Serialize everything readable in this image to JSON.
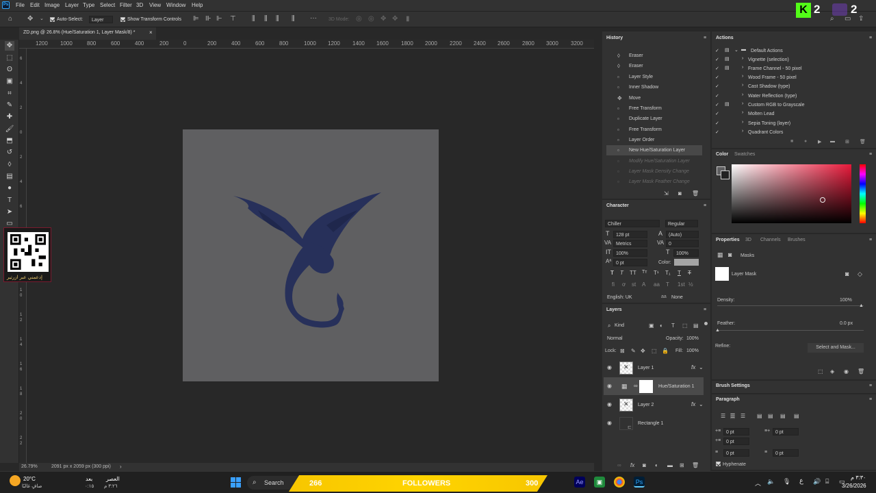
{
  "menubar": {
    "logo": "Ps",
    "items": [
      "File",
      "Edit",
      "Image",
      "Layer",
      "Type",
      "Select",
      "Filter",
      "3D",
      "View",
      "Window",
      "Help"
    ]
  },
  "options": {
    "auto_select_label": "Auto-Select:",
    "auto_select_value": "Layer",
    "show_transform_label": "Show Transform Controls",
    "mode_3d_label": "3D Mode:"
  },
  "doc_tab": {
    "title": "ZD.png @ 26.8% (Hue/Saturation 1, Layer Mask/8) *",
    "close": "×"
  },
  "ruler_h": [
    "1200",
    "1000",
    "800",
    "600",
    "400",
    "200",
    "0",
    "200",
    "400",
    "600",
    "800",
    "1000",
    "1200",
    "1400",
    "1600",
    "1800",
    "2000",
    "2200",
    "2400",
    "2600",
    "2800",
    "3000",
    "3200"
  ],
  "ruler_v": [
    "6",
    "4",
    "2",
    "0",
    "2",
    "4",
    "6",
    "8",
    "1",
    "0",
    "1",
    "2",
    "1",
    "4",
    "1",
    "6",
    "1",
    "8",
    "2",
    "0",
    "2",
    "2",
    "2",
    "4",
    "2",
    "6",
    "2",
    "8",
    "3",
    "0"
  ],
  "qr": {
    "caption": "إدعمني عبر ازرتير"
  },
  "status": {
    "zoom": "26.79%",
    "doc_info": "2091 px x 2059 px (300 ppi)"
  },
  "history": {
    "title": "History",
    "items": [
      {
        "label": "Eraser",
        "icon": "eraser-icon"
      },
      {
        "label": "Eraser",
        "icon": "eraser-icon"
      },
      {
        "label": "Layer Style",
        "icon": "doc-icon"
      },
      {
        "label": "Inner Shadow",
        "icon": "doc-icon"
      },
      {
        "label": "Move",
        "icon": "move-icon"
      },
      {
        "label": "Free Transform",
        "icon": "doc-icon"
      },
      {
        "label": "Duplicate Layer",
        "icon": "doc-icon"
      },
      {
        "label": "Free Transform",
        "icon": "doc-icon"
      },
      {
        "label": "Layer Order",
        "icon": "doc-icon"
      },
      {
        "label": "New Hue/Saturation Layer",
        "icon": "doc-icon"
      },
      {
        "label": "Modify Hue/Saturation Layer",
        "icon": "doc-icon"
      },
      {
        "label": "Layer Mask Density Change",
        "icon": "doc-icon"
      },
      {
        "label": "Layer Mask Feather Change",
        "icon": "doc-icon"
      }
    ]
  },
  "actions": {
    "title": "Actions",
    "group": "Default Actions",
    "items": [
      "Vignette (selection)",
      "Frame Channel - 50 pixel",
      "Wood Frame - 50 pixel",
      "Cast Shadow (type)",
      "Water Reflection (type)",
      "Custom RGB to Grayscale",
      "Molten Lead",
      "Sepia Toning (layer)",
      "Quadrant Colors"
    ]
  },
  "color": {
    "tab1": "Color",
    "tab2": "Swatches"
  },
  "character": {
    "title": "Character",
    "font": "Chiller",
    "style": "Regular",
    "size": "128 pt",
    "leading": "(Auto)",
    "kerning": "Metrics",
    "tracking": "0",
    "vscale": "100%",
    "hscale": "100%",
    "baseline": "0 pt",
    "color_label": "Color:",
    "language": "English: UK",
    "aa": "None"
  },
  "properties": {
    "tabs": [
      "Properties",
      "3D",
      "Channels",
      "Brushes"
    ],
    "masks_label": "Masks",
    "layer_mask_label": "Layer Mask",
    "density_label": "Density:",
    "density_value": "100%",
    "feather_label": "Feather:",
    "feather_value": "0.0 px",
    "refine_label": "Refine:",
    "select_mask_button": "Select and Mask..."
  },
  "brush_settings": {
    "title": "Brush Settings"
  },
  "paragraph": {
    "title": "Paragraph",
    "indent_left": "0 pt",
    "indent_right": "0 pt",
    "first_line": "0 pt",
    "space_before": "0 pt",
    "space_after": "0 pt",
    "hyphenate": "Hyphenate"
  },
  "layers": {
    "title": "Layers",
    "kind": "Kind",
    "blend": "Normal",
    "opacity_label": "Opacity:",
    "opacity_value": "100%",
    "lock_label": "Lock:",
    "fill_label": "Fill:",
    "fill_value": "100%",
    "items": [
      {
        "name": "Layer 1",
        "fx": "fx"
      },
      {
        "name": "Hue/Saturation 1",
        "fx": ""
      },
      {
        "name": "Layer 2",
        "fx": "fx"
      },
      {
        "name": "Rectangle 1",
        "fx": ""
      }
    ]
  },
  "overlay": {
    "k_count": "2",
    "purple_count": "2"
  },
  "taskbar": {
    "temp": "20°C",
    "weather": "صافٍ غالبًا",
    "prayer1_name": "بعد",
    "prayer1_time": "٠:١٥",
    "prayer2_name": "العصر",
    "prayer2_time": "٣:٢٦ م",
    "search": "Search",
    "banner_left": "266",
    "banner_mid": "FOLLOWERS",
    "banner_right": "300",
    "lang": "ع",
    "time": "٣:٣٠ م",
    "date": "3/26/2026"
  }
}
